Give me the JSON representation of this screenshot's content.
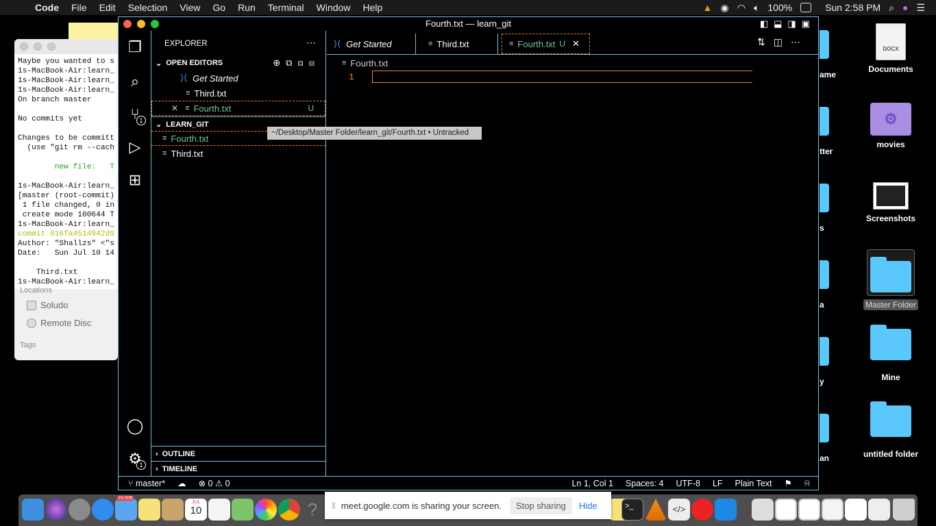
{
  "menubar": {
    "app_name": "Code",
    "items": [
      "File",
      "Edit",
      "Selection",
      "View",
      "Go",
      "Run",
      "Terminal",
      "Window",
      "Help"
    ],
    "battery": "100%",
    "clock": "Sun 2:58 PM"
  },
  "terminal": {
    "lines": [
      "Maybe you wanted to s",
      "1s-MacBook-Air:learn_",
      "1s-MacBook-Air:learn_",
      "1s-MacBook-Air:learn_",
      "On branch master",
      "",
      "No commits yet",
      "",
      "Changes to be committ",
      "  (use \"git rm --cach",
      "",
      "        new file:   T",
      "",
      "1s-MacBook-Air:learn_",
      "[master (root-commit)",
      " 1 file changed, 0 in",
      " create mode 100644 T",
      "1s-MacBook-Air:learn_",
      "commit 016fa4514942d9",
      "Author: \"Shallzs\" <\"s",
      "Date:   Sun Jul 10 14",
      "",
      "    Third.txt",
      "1s-MacBook-Air:learn_"
    ]
  },
  "finder": {
    "locations_label": "Locations",
    "items": [
      "Soludo",
      "Remote Disc"
    ],
    "tags_label": "Tags"
  },
  "desktop": {
    "items": [
      "Documents",
      "movies",
      "Screenshots",
      "Master Folder",
      "Mine",
      "untitled folder"
    ],
    "partial_labels": [
      "ame",
      "tter",
      "s",
      "a",
      "y",
      "an"
    ]
  },
  "vscode": {
    "window_title": "Fourth.txt — learn_git",
    "explorer_title": "EXPLORER",
    "open_editors_title": "OPEN EDITORS",
    "open_editors": [
      "Get Started",
      "Third.txt",
      "Fourth.txt"
    ],
    "untracked_badge": "U",
    "project_title": "LEARN_GIT",
    "project_files": [
      "Fourth.txt",
      "Third.txt"
    ],
    "outline_title": "OUTLINE",
    "timeline_title": "TIMELINE",
    "tabs": [
      "Get Started",
      "Third.txt",
      "Fourth.txt"
    ],
    "breadcrumb": "Fourth.txt",
    "line_number": "1",
    "tooltip": "~/Desktop/Master Folder/learn_git/Fourth.txt • Untracked",
    "scm_badge": "1",
    "settings_badge": "1",
    "status": {
      "branch": "master*",
      "errors": "0",
      "warnings": "0",
      "position": "Ln 1, Col 1",
      "spaces": "Spaces: 4",
      "encoding": "UTF-8",
      "eol": "LF",
      "language": "Plain Text"
    }
  },
  "sharebar": {
    "message": "meet.google.com is sharing your screen.",
    "stop": "Stop sharing",
    "hide": "Hide"
  },
  "dock": {
    "calendar_month": "JUL",
    "calendar_day": "10",
    "mail_badge": "19,508"
  },
  "colors": {
    "border": "#6fc3df",
    "untracked": "#73c991",
    "cursor_line": "#f38518",
    "desktop_folder": "#5ac8fa"
  }
}
